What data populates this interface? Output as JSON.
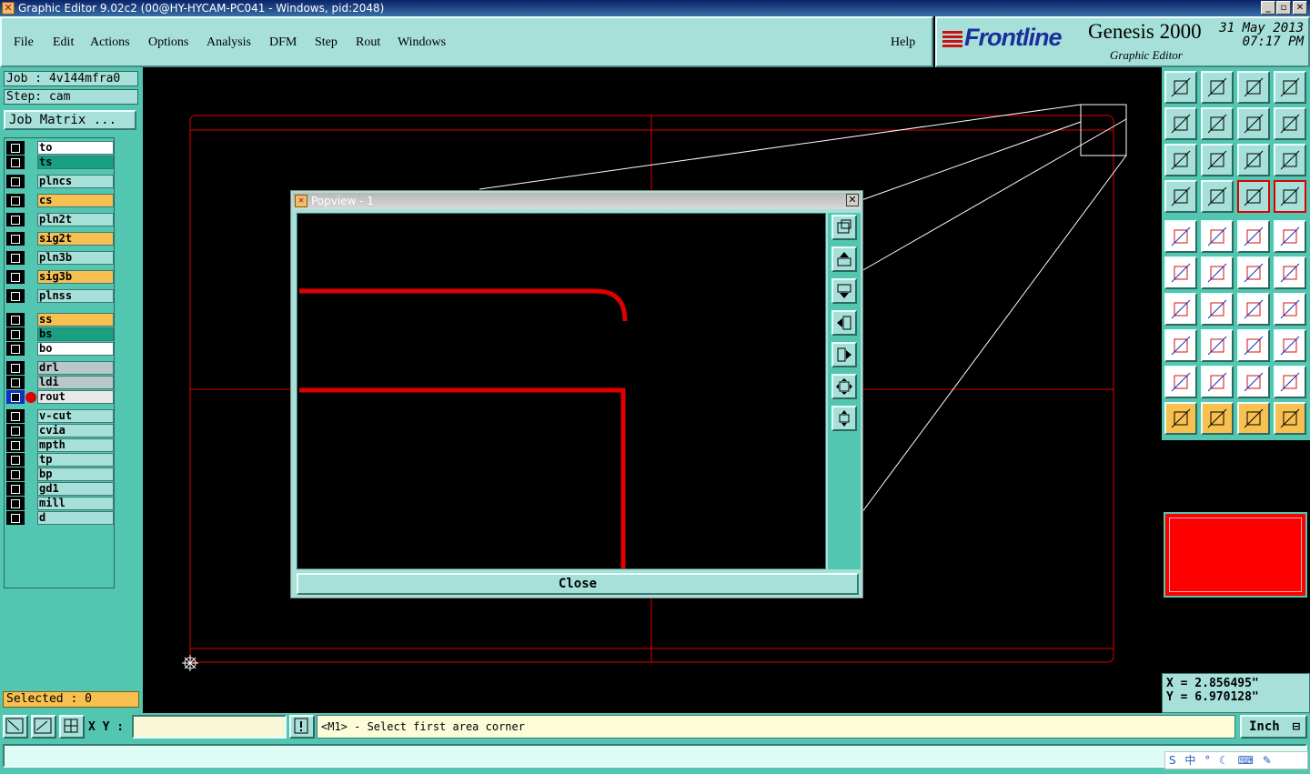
{
  "window": {
    "title": "Graphic Editor 9.02c2 (00@HY-HYCAM-PC041 - Windows, pid:2048)"
  },
  "menu": {
    "items": [
      "File",
      "Edit",
      "Actions",
      "Options",
      "Analysis",
      "DFM",
      "Step",
      "Rout",
      "Windows"
    ],
    "help": "Help"
  },
  "logo": {
    "brand": "Frontline",
    "product": "Genesis 2000",
    "subtitle": "Graphic Editor",
    "date": "31 May 2013",
    "time": "07:17 PM"
  },
  "job": {
    "job_label": "Job : 4v144mfra0",
    "step_label": "Step: cam",
    "matrix_button": "Job Matrix ..."
  },
  "layers": [
    {
      "name": "to",
      "color": "#ffffff"
    },
    {
      "name": "ts",
      "color": "#18a080"
    },
    {
      "name": "plncs",
      "color": "#a6e0d8"
    },
    {
      "name": "cs",
      "color": "#f8c050"
    },
    {
      "name": "pln2t",
      "color": "#a6e0d8"
    },
    {
      "name": "sig2t",
      "color": "#f8c050"
    },
    {
      "name": "pln3b",
      "color": "#a6e0d8"
    },
    {
      "name": "sig3b",
      "color": "#f8c050"
    },
    {
      "name": "plnss",
      "color": "#a6e0d8"
    },
    {
      "name": "ss",
      "color": "#f8c050"
    },
    {
      "name": "bs",
      "color": "#18a080"
    },
    {
      "name": "bo",
      "color": "#ffffff"
    },
    {
      "name": "drl",
      "color": "#b8c8c8"
    },
    {
      "name": "ldi",
      "color": "#b8c8c8"
    },
    {
      "name": "rout",
      "color": "#e8e8e8",
      "active": true
    },
    {
      "name": "v-cut",
      "color": "#a6e0d8"
    },
    {
      "name": "cvia",
      "color": "#a6e0d8"
    },
    {
      "name": "mpth",
      "color": "#a6e0d8"
    },
    {
      "name": "tp",
      "color": "#a6e0d8"
    },
    {
      "name": "bp",
      "color": "#a6e0d8"
    },
    {
      "name": "gd1",
      "color": "#a6e0d8"
    },
    {
      "name": "mill",
      "color": "#a6e0d8"
    },
    {
      "name": "d",
      "color": "#a6e0d8"
    }
  ],
  "selected_label": "Selected : 0",
  "popview": {
    "title": "Popview - 1",
    "close_label": "Close"
  },
  "coords": {
    "x": "X = 2.856495\"",
    "y": "Y = 6.970128\""
  },
  "status": {
    "xy_label": "X Y :",
    "xy_value": "",
    "prompt": "<M1> - Select first area corner",
    "units": "Inch"
  },
  "tray": {
    "text": "S 中 ° ☾ ⌨ ✎"
  },
  "colors": {
    "work_layer": "#ff0000",
    "panel": "#52c6b0",
    "button": "#a6e0d8",
    "accent_yellow": "#f8c050"
  }
}
